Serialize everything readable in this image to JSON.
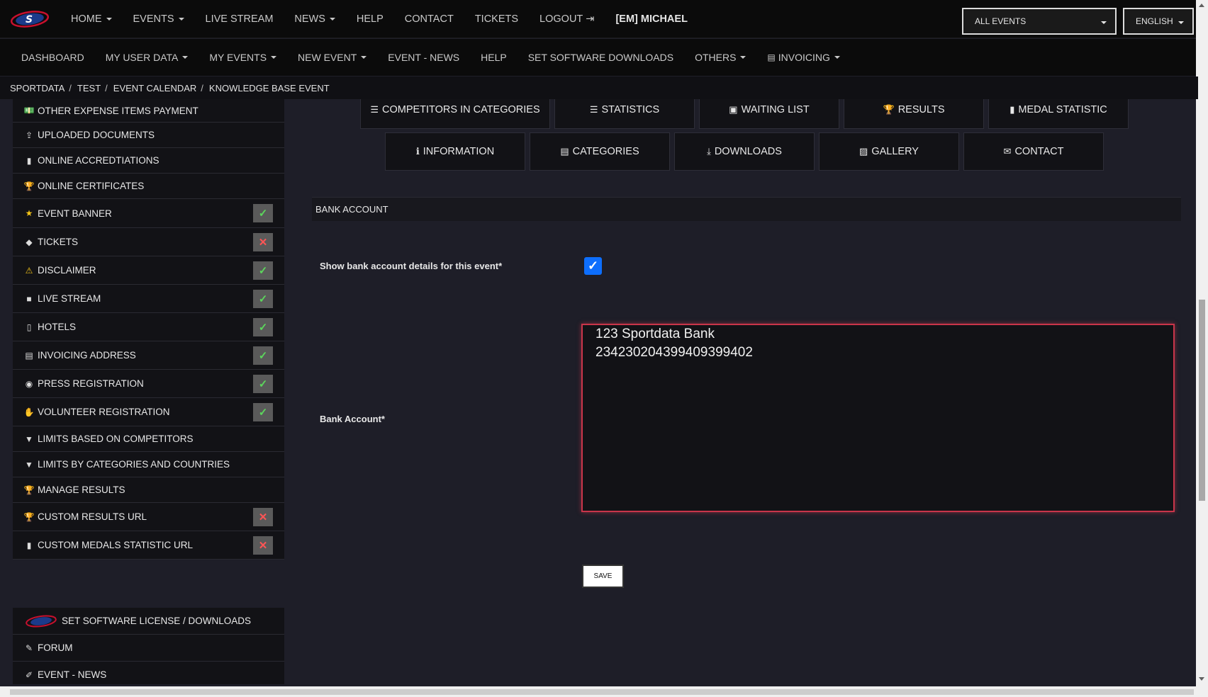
{
  "topnav": {
    "items": [
      {
        "label": "HOME",
        "caret": true
      },
      {
        "label": "EVENTS",
        "caret": true
      },
      {
        "label": "LIVE STREAM",
        "caret": false
      },
      {
        "label": "NEWS",
        "caret": true
      },
      {
        "label": "HELP",
        "caret": false
      },
      {
        "label": "CONTACT",
        "caret": false
      },
      {
        "label": "TICKETS",
        "caret": false
      },
      {
        "label": "LOGOUT",
        "caret": false
      }
    ],
    "user": "[EM] MICHAEL",
    "event_select": "ALL EVENTS",
    "language_select": "ENGLISH"
  },
  "subnav": {
    "items": [
      {
        "label": "DASHBOARD",
        "caret": false
      },
      {
        "label": "MY USER DATA",
        "caret": true
      },
      {
        "label": "MY EVENTS",
        "caret": true
      },
      {
        "label": "NEW EVENT",
        "caret": true
      },
      {
        "label": "EVENT - NEWS",
        "caret": false
      },
      {
        "label": "HELP",
        "caret": false
      },
      {
        "label": "SET SOFTWARE DOWNLOADS",
        "caret": false
      },
      {
        "label": "OTHERS",
        "caret": true
      },
      {
        "label": "INVOICING",
        "caret": true
      }
    ]
  },
  "breadcrumb": [
    "SPORTDATA",
    "TEST",
    "EVENT CALENDAR",
    "KNOWLEDGE BASE EVENT"
  ],
  "sidebar": {
    "items": [
      {
        "label": "OTHER EXPENSE ITEMS PAYMENT",
        "icon": "money-icon",
        "status": ""
      },
      {
        "label": "UPLOADED DOCUMENTS",
        "icon": "upload-icon",
        "status": ""
      },
      {
        "label": "ONLINE ACCREDTIATIONS",
        "icon": "badge-icon",
        "status": ""
      },
      {
        "label": "ONLINE CERTIFICATES",
        "icon": "trophy-icon",
        "status": ""
      },
      {
        "label": "EVENT BANNER",
        "icon": "star-icon",
        "status": "ok"
      },
      {
        "label": "TICKETS",
        "icon": "ticket-icon",
        "status": "no"
      },
      {
        "label": "DISCLAIMER",
        "icon": "warning-icon",
        "status": "ok"
      },
      {
        "label": "LIVE STREAM",
        "icon": "video-icon",
        "status": "ok"
      },
      {
        "label": "HOTELS",
        "icon": "luggage-icon",
        "status": "ok"
      },
      {
        "label": "INVOICING ADDRESS",
        "icon": "invoice-icon",
        "status": "ok"
      },
      {
        "label": "PRESS REGISTRATION",
        "icon": "camera-icon",
        "status": "ok"
      },
      {
        "label": "VOLUNTEER REGISTRATION",
        "icon": "hand-icon",
        "status": "ok"
      },
      {
        "label": "LIMITS BASED ON COMPETITORS",
        "icon": "filter-icon",
        "status": ""
      },
      {
        "label": "LIMITS BY CATEGORIES AND COUNTRIES",
        "icon": "filter-icon",
        "status": ""
      },
      {
        "label": "MANAGE RESULTS",
        "icon": "trophy-icon",
        "status": ""
      },
      {
        "label": "CUSTOM RESULTS URL",
        "icon": "trophy-icon",
        "status": "no"
      },
      {
        "label": "CUSTOM MEDALS STATISTIC URL",
        "icon": "bar-chart-icon",
        "status": "no"
      }
    ],
    "bottom_items": [
      {
        "label": "SET SOFTWARE LICENSE / DOWNLOADS",
        "icon": "logo-icon"
      },
      {
        "label": "FORUM",
        "icon": "forum-icon"
      },
      {
        "label": "EVENT - NEWS",
        "icon": "news-icon"
      }
    ]
  },
  "tabs_row1": [
    {
      "label": "COMPETITORS IN CATEGORIES",
      "icon": "list-check-icon"
    },
    {
      "label": "STATISTICS",
      "icon": "list-icon"
    },
    {
      "label": "WAITING LIST",
      "icon": "clipboard-icon"
    },
    {
      "label": "RESULTS",
      "icon": "trophy-icon"
    },
    {
      "label": "MEDAL STATISTIC",
      "icon": "bar-chart-icon"
    }
  ],
  "tabs_row2": [
    {
      "label": "INFORMATION",
      "icon": "info-icon"
    },
    {
      "label": "CATEGORIES",
      "icon": "copy-icon"
    },
    {
      "label": "DOWNLOADS",
      "icon": "download-icon"
    },
    {
      "label": "GALLERY",
      "icon": "image-icon"
    },
    {
      "label": "CONTACT",
      "icon": "envelope-icon"
    }
  ],
  "bank_form": {
    "section_title": "BANK ACCOUNT",
    "show_label": "Show bank account details for this event*",
    "show_checked": true,
    "account_label": "Bank Account*",
    "account_line1": "123 Sportdata Bank",
    "account_line2": "234230204399409399402",
    "save_label": "SAVE"
  }
}
